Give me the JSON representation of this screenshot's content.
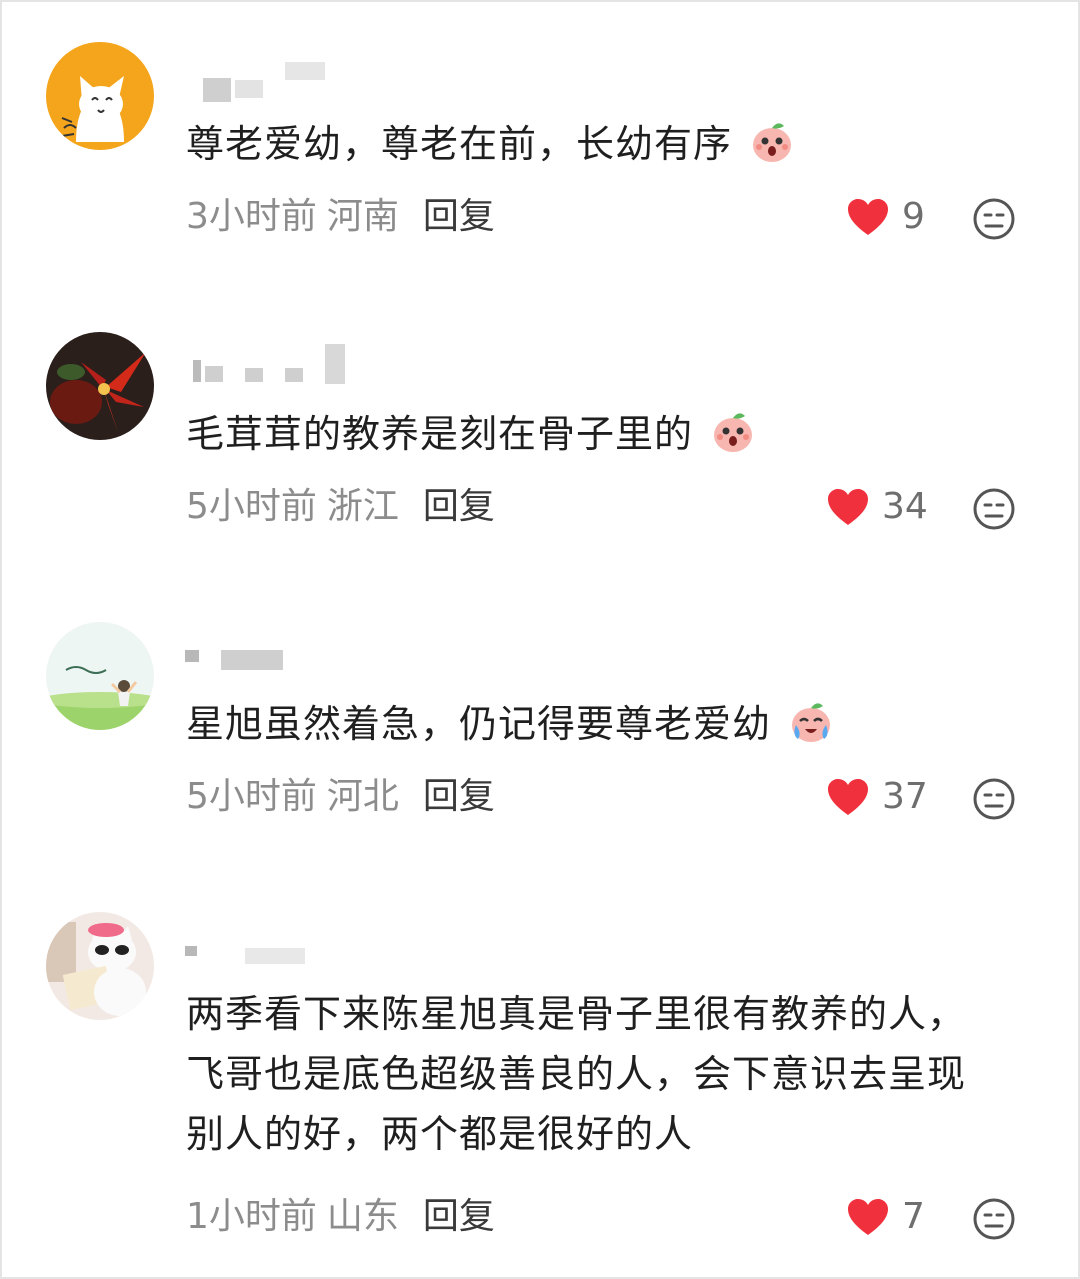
{
  "comments": [
    {
      "text": "尊老爱幼，尊老在前，长幼有序",
      "time": "3小时前",
      "location": "河南",
      "reply": "回复",
      "likes": "9",
      "avatar": "cat-avatar",
      "emoji": "peach-shocked-emoji"
    },
    {
      "text": "毛茸茸的教养是刻在骨子里的",
      "time": "5小时前",
      "location": "浙江",
      "reply": "回复",
      "likes": "34",
      "avatar": "red-flower-avatar",
      "emoji": "peach-shocked-emoji"
    },
    {
      "text": "星旭虽然着急，仍记得要尊老爱幼",
      "time": "5小时前",
      "location": "河北",
      "reply": "回复",
      "likes": "37",
      "avatar": "meadow-avatar",
      "emoji": "peach-crying-emoji"
    },
    {
      "text_lines": [
        "两季看下来陈星旭真是骨子里很有教养的人，",
        "飞哥也是底色超级善良的人，会下意识去呈现",
        "别人的好，两个都是很好的人"
      ],
      "time": "1小时前",
      "location": "山东",
      "reply": "回复",
      "likes": "7",
      "avatar": "white-cat-avatar"
    }
  ],
  "colors": {
    "heart": "#f0313d",
    "meta": "#8c8c8c",
    "text": "#1f1f1f"
  },
  "icons": {
    "like": "heart-icon",
    "reaction": "neutral-face-icon"
  }
}
